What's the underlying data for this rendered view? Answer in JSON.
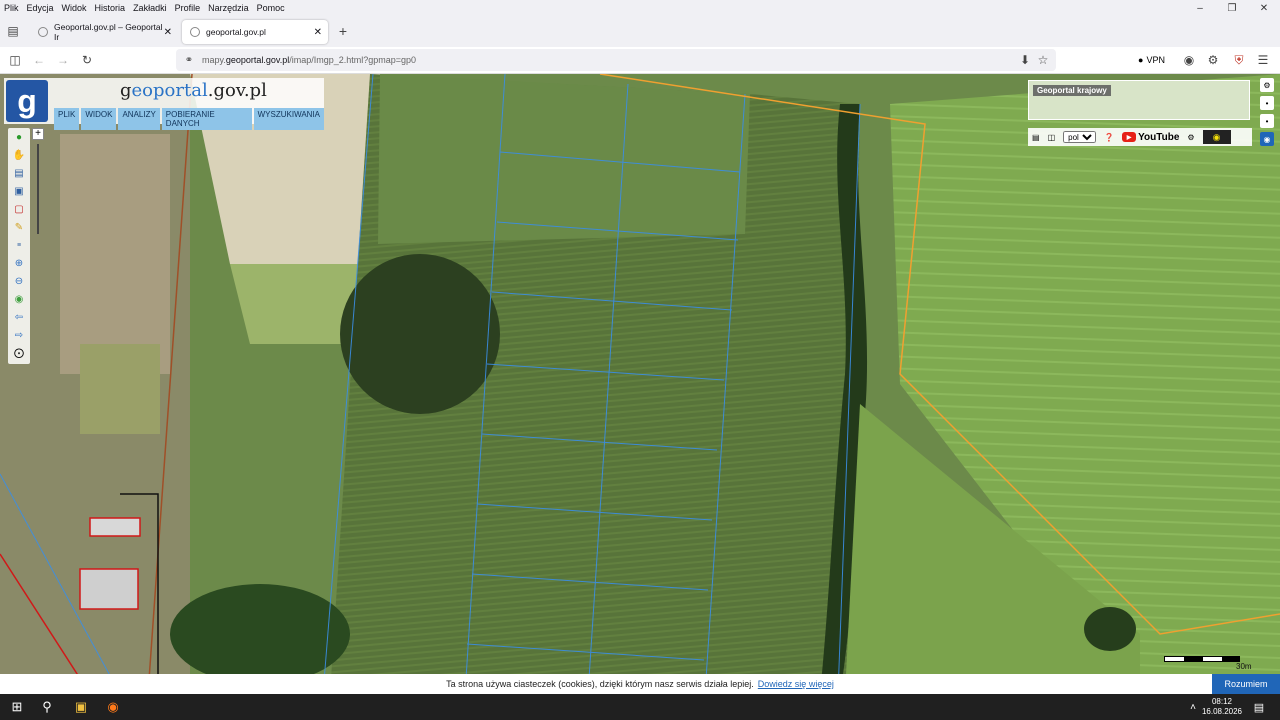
{
  "menubar": {
    "items": [
      "Plik",
      "Edycja",
      "Widok",
      "Historia",
      "Zakładki",
      "Profile",
      "Narzędzia",
      "Pomoc"
    ]
  },
  "tabs": [
    {
      "label": "Geoportal.gov.pl – Geoportal Ir",
      "active": false
    },
    {
      "label": "geoportal.gov.pl",
      "active": true
    }
  ],
  "address": {
    "prefix": "mapy.",
    "domain": "geoportal.gov.pl",
    "path": "/imap/Imgp_2.html?gpmap=gp0"
  },
  "toolbar_right": {
    "vpn_label": "VPN"
  },
  "geoportal": {
    "logo_letter": "g",
    "title_prefix": "g",
    "title_colored": "eoportal",
    "title_suffix": ".gov.pl",
    "menu": [
      "PLIK",
      "WIDOK",
      "ANALIZY",
      "POBIERANIE DANYCH",
      "WYSZUKIWANIA"
    ],
    "minimap_label": "Geoportal krajowy",
    "lang_value": "pol",
    "youtube_label": "YouTube",
    "scale_label": "30m"
  },
  "cookie": {
    "text": "Ta strona używa ciasteczek (cookies), dzięki którym nasz serwis działa lepiej.",
    "link": "Dowiedz się więcej",
    "button": "Rozumiem"
  },
  "clock": {
    "time": "08:12",
    "date": "16.08.2026"
  },
  "colors": {
    "accent": "#2066b8",
    "parcel_line": "#3b8ee6",
    "boundary_line": "#f0a030"
  }
}
